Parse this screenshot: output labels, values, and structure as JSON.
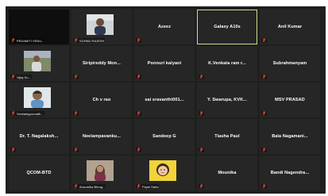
{
  "participants": [
    {
      "name": "PEDAMITI VENU...",
      "label_pos": "bottom",
      "video": false,
      "muted": true,
      "style": "dark"
    },
    {
      "name": "SOHNU RAJESH",
      "label_pos": "bottom",
      "video": true,
      "kind": "person-whitewall",
      "muted": true
    },
    {
      "name": "Azeez",
      "label_pos": "center",
      "video": false,
      "muted": true
    },
    {
      "name": "Galaxy A10s",
      "label_pos": "center",
      "video": false,
      "muted": false,
      "active": true
    },
    {
      "name": "Anil Kumar",
      "label_pos": "center",
      "video": false,
      "muted": true
    },
    {
      "name": "Vijay Ku...",
      "label_pos": "bottom",
      "video": true,
      "kind": "person-outdoor",
      "muted": true
    },
    {
      "name": "Siripireddy Mon...",
      "label_pos": "center",
      "video": false,
      "muted": true
    },
    {
      "name": "Ponnuri kalyani",
      "label_pos": "center",
      "video": false,
      "muted": true
    },
    {
      "name": "K.Venkata ram r...",
      "label_pos": "center",
      "video": false,
      "muted": true
    },
    {
      "name": "Subrahmanyam",
      "label_pos": "center",
      "video": false,
      "muted": true
    },
    {
      "name": "Venkatagurunath...",
      "label_pos": "bottom",
      "video": true,
      "kind": "person-portrait",
      "muted": true
    },
    {
      "name": "Ch v rao",
      "label_pos": "center",
      "video": false,
      "muted": true
    },
    {
      "name": "sai sravanthi001...",
      "label_pos": "center",
      "video": false,
      "muted": true
    },
    {
      "name": "Y. Swarupa, KVK...",
      "label_pos": "center",
      "video": false,
      "muted": true
    },
    {
      "name": "MSV PRASAD",
      "label_pos": "center",
      "video": false,
      "muted": true
    },
    {
      "name": "Dr. T. Nagalaksh...",
      "label_pos": "center",
      "video": false,
      "muted": true
    },
    {
      "name": "Neelampavanku...",
      "label_pos": "center",
      "video": false,
      "muted": true
    },
    {
      "name": "Sandeep G",
      "label_pos": "center",
      "video": false,
      "muted": true
    },
    {
      "name": "Tiasha Paul",
      "label_pos": "center",
      "video": false,
      "muted": true
    },
    {
      "name": "Bala Nagamani...",
      "label_pos": "center",
      "video": false,
      "muted": true
    },
    {
      "name": "QCOM-BTD",
      "label_pos": "center",
      "video": false,
      "muted": false
    },
    {
      "name": "Anuradha Bhrug...",
      "label_pos": "bottom",
      "video": true,
      "kind": "person-woman",
      "muted": true
    },
    {
      "name": "Payel Saha",
      "label_pos": "bottom",
      "video": true,
      "kind": "avatar-cartoon",
      "muted": true
    },
    {
      "name": "Mounika",
      "label_pos": "center",
      "video": false,
      "muted": true
    },
    {
      "name": "Bandi Nagendra...",
      "label_pos": "center",
      "video": false,
      "muted": true
    }
  ],
  "icons": {
    "muted": "mic-muted-icon"
  },
  "colors": {
    "active_border": "#c9e27d",
    "muted_icon": "#e5463e",
    "tile_bg": "#262626",
    "frame_bg": "#1f1f1f"
  }
}
